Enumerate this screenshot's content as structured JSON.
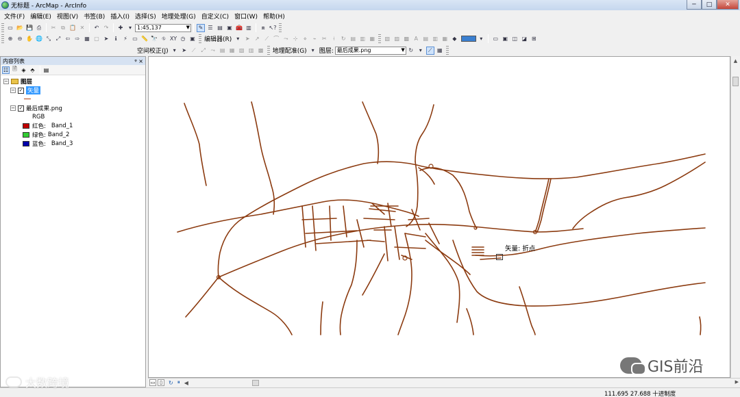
{
  "window": {
    "title": "无标题 - ArcMap - ArcInfo",
    "minimize": "─",
    "maximize": "□",
    "close": "✕"
  },
  "menu": [
    "文件(F)",
    "编辑(E)",
    "视图(V)",
    "书签(B)",
    "插入(I)",
    "选择(S)",
    "地理处理(G)",
    "自定义(C)",
    "窗口(W)",
    "帮助(H)"
  ],
  "toolbar": {
    "scale": "1:45,137",
    "editor_label": "编辑器(R)",
    "spatial_adjust_label": "空间校正(J)",
    "georef_label": "地理配准(G)",
    "layer_label": "图层:",
    "layer_value": "最后成果.png"
  },
  "toc": {
    "title": "内容列表",
    "pin": "ᵠ ×",
    "root_layer": "图层",
    "layers": [
      {
        "name": "矢量",
        "checked": "✓",
        "expander": "−"
      },
      {
        "name": "最后成果.png",
        "checked": "✓",
        "expander": "−",
        "renderer": "RGB",
        "bands": [
          {
            "channel": "红色:",
            "band": "Band_1",
            "color": "#c00000"
          },
          {
            "channel": "绿色:",
            "band": "Band_2",
            "color": "#33cc33"
          },
          {
            "channel": "蓝色:",
            "band": "Band_3",
            "color": "#0000aa"
          }
        ]
      }
    ]
  },
  "map": {
    "line_color": "#8b3a0f",
    "snap_tip": "矢量: 折点"
  },
  "status": {
    "coords": "111.695  27.688 十进制度"
  },
  "watermark": {
    "left": "大数跨境",
    "right": "GIS前沿"
  }
}
